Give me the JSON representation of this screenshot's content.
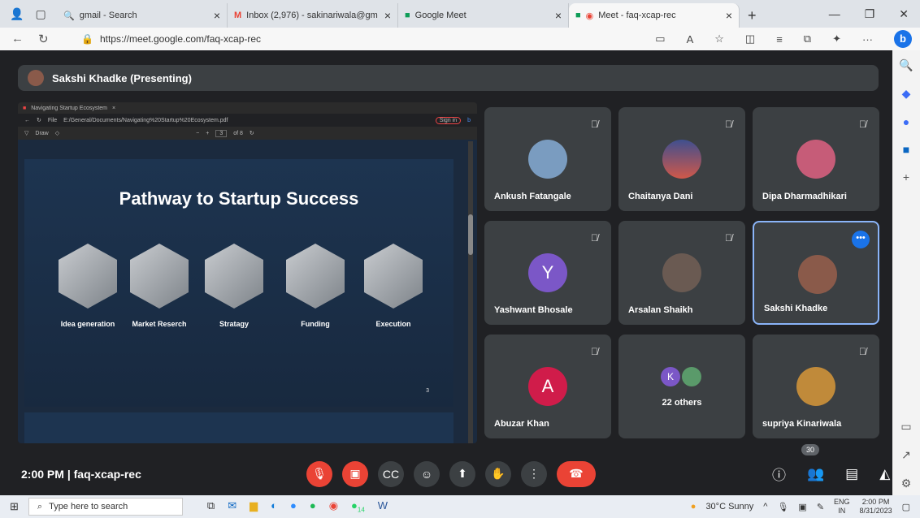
{
  "browser": {
    "tabs": [
      {
        "title": "gmail - Search",
        "icon": "search-icon"
      },
      {
        "title": "Inbox (2,976) - sakinariwala@gm",
        "icon": "gmail-icon"
      },
      {
        "title": "Google Meet",
        "icon": "meet-icon"
      },
      {
        "title": "Meet - faq-xcap-rec",
        "icon": "meet-icon",
        "active": true
      }
    ],
    "url": "https://meet.google.com/faq-xcap-rec"
  },
  "meeting": {
    "presenter_label": "Sakshi Khadke (Presenting)",
    "time": "2:00 PM",
    "code": "faq-xcap-rec",
    "participant_count": "30"
  },
  "pdf": {
    "tab_title": "Navigating Startup Ecosystem",
    "file_label": "File",
    "path": "E:/General/Documents/Navigating%20Startup%20Ecosystem.pdf",
    "sign_in": "Sign in",
    "draw": "Draw",
    "page": "3",
    "page_of": "of 8"
  },
  "slide": {
    "title": "Pathway to Startup Success",
    "stages": [
      "Idea generation",
      "Market Reserch",
      "Stratagy",
      "Funding",
      "Execution"
    ],
    "page_number": "3"
  },
  "participants": [
    {
      "name": "Ankush Fatangale",
      "muted": true,
      "avatar": "photo"
    },
    {
      "name": "Chaitanya Dani",
      "muted": true,
      "avatar": "photo"
    },
    {
      "name": "Dipa Dharmadhikari",
      "muted": true,
      "avatar": "photo"
    },
    {
      "name": "Yashwant Bhosale",
      "muted": true,
      "avatar": "Y",
      "color": "#7b57c7"
    },
    {
      "name": "Arsalan Shaikh",
      "muted": true,
      "avatar": "photo"
    },
    {
      "name": "Sakshi Khadke",
      "muted": false,
      "avatar": "photo",
      "highlighted": true
    },
    {
      "name": "Abuzar Khan",
      "muted": true,
      "avatar": "A",
      "color": "#d01c4a"
    },
    {
      "name": "22 others",
      "muted": false,
      "avatar": "K",
      "color": "#7b57c7"
    },
    {
      "name": "supriya Kinariwala",
      "muted": true,
      "avatar": "photo"
    }
  ],
  "taskbar": {
    "search_placeholder": "Type here to search",
    "weather": "30°C  Sunny",
    "lang1": "ENG",
    "lang2": "IN",
    "time": "2:00 PM",
    "date": "8/31/2023",
    "whatsapp_badge": "14"
  }
}
